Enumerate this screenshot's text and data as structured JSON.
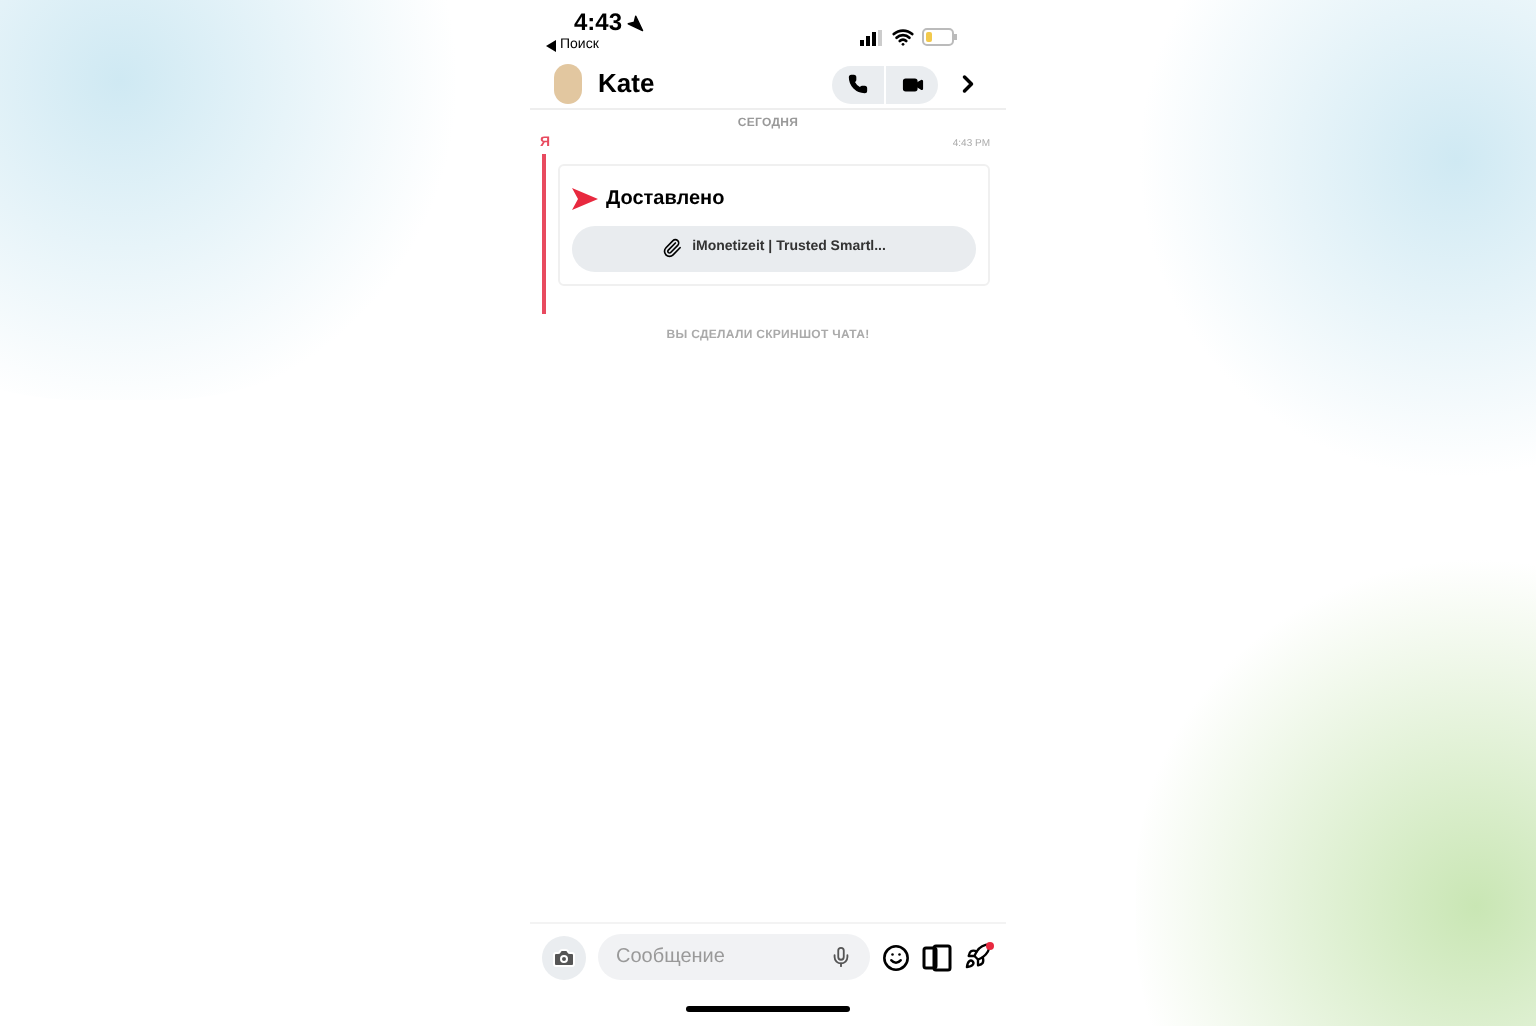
{
  "status_bar": {
    "time": "4:43",
    "back_label": "Поиск"
  },
  "header": {
    "contact_name": "Kate"
  },
  "chat": {
    "date_label": "СЕГОДНЯ",
    "sender": "Я",
    "timestamp": "4:43 PM",
    "delivery_status": "Доставлено",
    "link_title": "iMonetizeit | Trusted Smartl...",
    "notice": "ВЫ СДЕЛАЛИ СКРИНШОТ ЧАТА!"
  },
  "composer": {
    "placeholder": "Сообщение",
    "rocket_has_notification": true
  }
}
